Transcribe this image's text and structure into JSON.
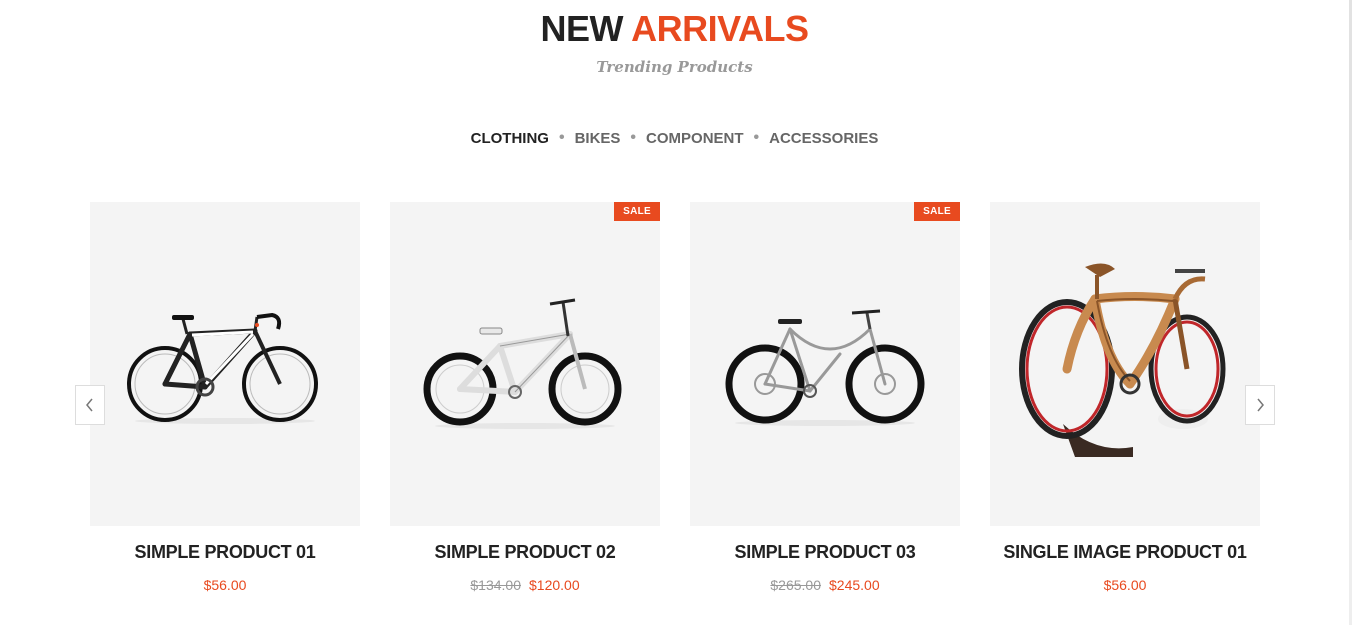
{
  "section": {
    "title_plain": "NEW",
    "title_accent": "ARRIVALS",
    "subtitle": "Trending Products"
  },
  "tabs": [
    {
      "label": "CLOTHING",
      "active": true
    },
    {
      "label": "BIKES",
      "active": false
    },
    {
      "label": "COMPONENT",
      "active": false
    },
    {
      "label": "ACCESSORIES",
      "active": false
    }
  ],
  "products": [
    {
      "name": "SIMPLE PRODUCT 01",
      "old_price": "",
      "price": "$56.00",
      "badge": ""
    },
    {
      "name": "SIMPLE PRODUCT 02",
      "old_price": "$134.00",
      "price": "$120.00",
      "badge": "SALE"
    },
    {
      "name": "SIMPLE PRODUCT 03",
      "old_price": "$265.00",
      "price": "$245.00",
      "badge": "SALE"
    },
    {
      "name": "SINGLE IMAGE PRODUCT 01",
      "old_price": "",
      "price": "$56.00",
      "badge": ""
    }
  ],
  "icons": {
    "prev": "chevron-left-icon",
    "next": "chevron-right-icon"
  },
  "colors": {
    "accent": "#e84a1f",
    "heading": "#222222",
    "card_bg": "#f4f4f4"
  }
}
